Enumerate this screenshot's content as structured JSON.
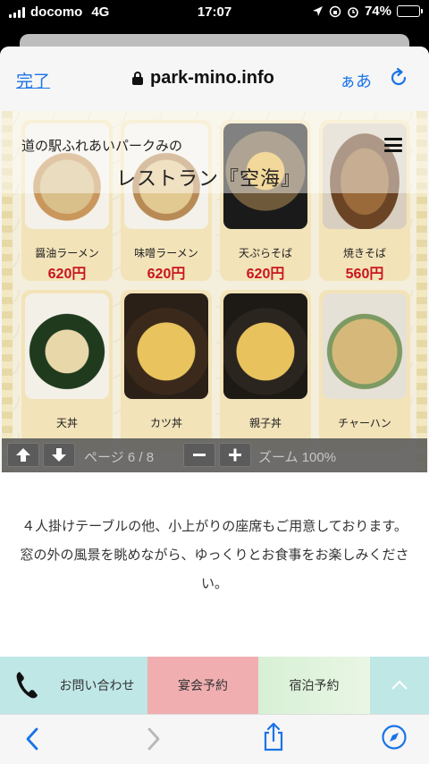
{
  "status_bar": {
    "carrier": "docomo",
    "network": "4G",
    "time": "17:07",
    "battery": "74%",
    "battery_level": 0.74
  },
  "browser": {
    "done_label": "完了",
    "url": "park-mino.info",
    "text_size_label": "ぁあ"
  },
  "pdf": {
    "subtitle": "道の駅ふれあいパークみの",
    "title": "レストラン『空海』",
    "menu": [
      {
        "name": "醤油ラーメン",
        "price": "620円",
        "photo": "ramen-soy"
      },
      {
        "name": "味噌ラーメン",
        "price": "620円",
        "photo": "ramen-miso"
      },
      {
        "name": "天ぷらそば",
        "price": "620円",
        "photo": "tempura"
      },
      {
        "name": "焼きそば",
        "price": "560円",
        "photo": "yakisoba"
      },
      {
        "name": "天丼",
        "photo": "tendon"
      },
      {
        "name": "カツ丼",
        "photo": "katsudon"
      },
      {
        "name": "親子丼",
        "photo": "oyakodon"
      },
      {
        "name": "チャーハン",
        "photo": "chahan"
      }
    ],
    "page_label": "ページ 6 / 8",
    "zoom_label": "ズーム 100%"
  },
  "content": {
    "description": "４人掛けテーブルの他、小上がりの座席もご用意しております。窓の外の風景を眺めながら、ゆっくりとお食事をお楽しみください。"
  },
  "actions": {
    "contact": "お問い合わせ",
    "banquet": "宴会予約",
    "stay": "宿泊予約"
  },
  "colors": {
    "link_blue": "#1a73e8",
    "price_red": "#c8161d",
    "contact_bg": "#bfe7e6",
    "banquet_bg": "#f0aeb0",
    "stay_bg": "#d7f0d5"
  }
}
